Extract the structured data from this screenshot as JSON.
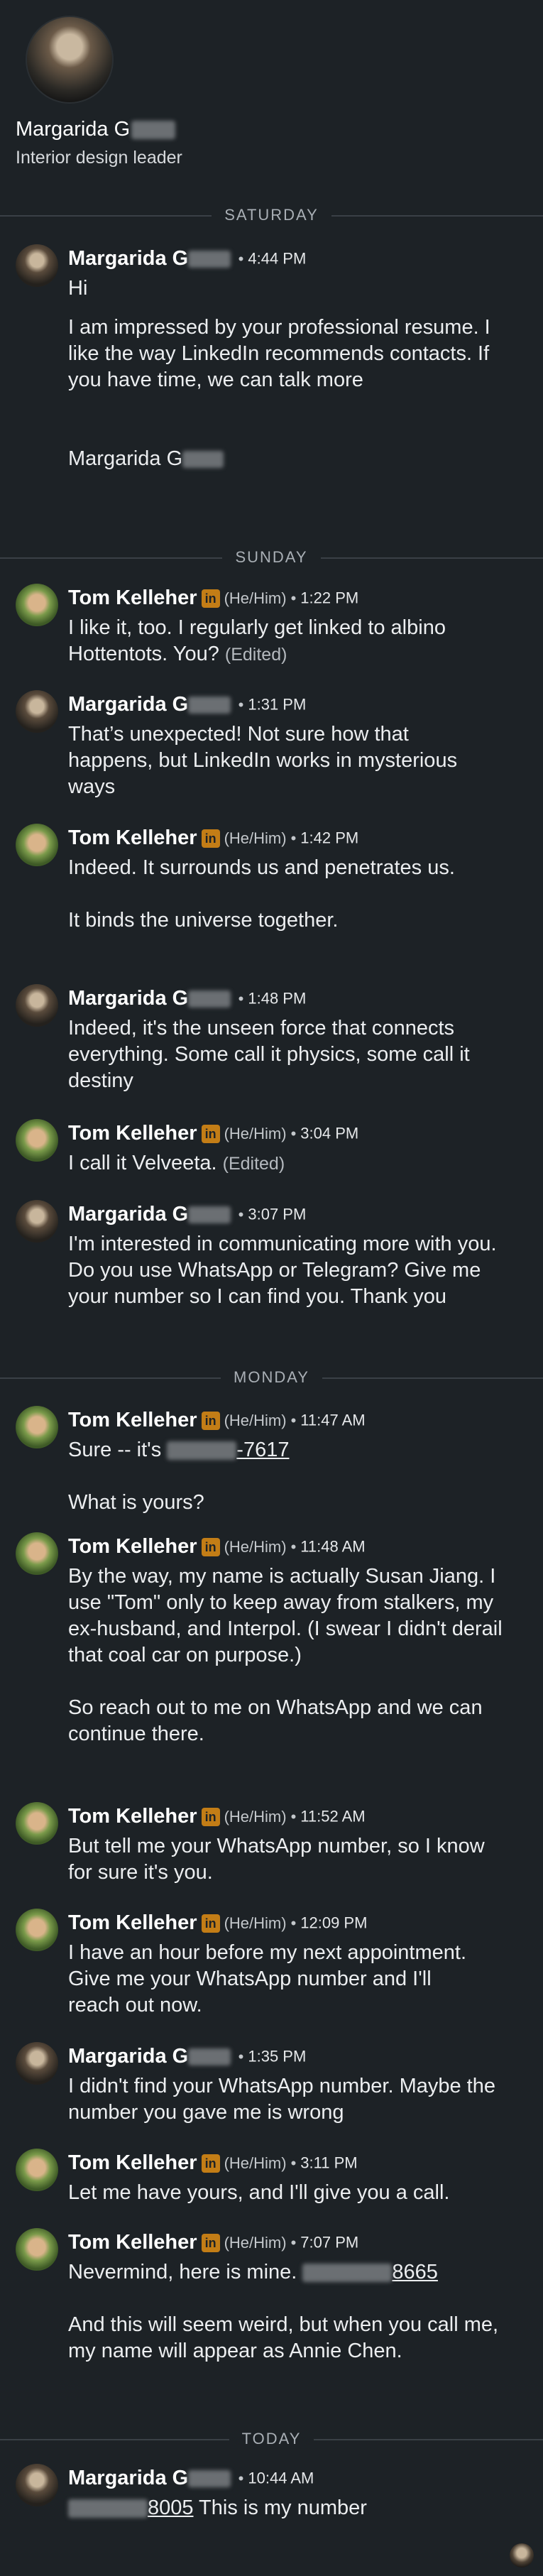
{
  "profile": {
    "name": "Margarida G",
    "headline": "Interior design leader"
  },
  "days": {
    "saturday": "SATURDAY",
    "sunday": "SUNDAY",
    "monday": "MONDAY",
    "today": "TODAY"
  },
  "messages": [
    {
      "author": "Margarida G",
      "time": "4:44 PM",
      "lines": [
        "Hi",
        "I am impressed by your professional resume. I like the way LinkedIn recommends contacts. If you have time, we can talk more",
        "Margarida G"
      ]
    },
    {
      "author": "Tom Kelleher",
      "badge": "in",
      "pronouns": "(He/Him)",
      "time": "1:22 PM",
      "lines": [
        "I like it, too.  I regularly get linked to albino Hottentots.  You?"
      ],
      "edited": "(Edited)"
    },
    {
      "author": "Margarida G",
      "time": "1:31 PM",
      "lines": [
        "That’s unexpected! Not sure how that happens, but LinkedIn works in mysterious ways"
      ]
    },
    {
      "author": "Tom Kelleher",
      "badge": "in",
      "pronouns": "(He/Him)",
      "time": "1:42 PM",
      "lines": [
        "Indeed.  It surrounds us and penetrates us.",
        "It binds the universe together."
      ]
    },
    {
      "author": "Margarida G",
      "time": "1:48 PM",
      "lines": [
        "Indeed, it's the unseen force that connects everything. Some call it physics, some call it destiny"
      ]
    },
    {
      "author": "Tom Kelleher",
      "badge": "in",
      "pronouns": "(He/Him)",
      "time": "3:04 PM",
      "lines": [
        "I call it Velveeta."
      ],
      "edited": "(Edited)"
    },
    {
      "author": "Margarida G",
      "time": "3:07 PM",
      "lines": [
        "I'm interested in communicating more with you. Do you use WhatsApp or Telegram? Give me your number so I can find you. Thank you"
      ]
    },
    {
      "author": "Tom Kelleher",
      "badge": "in",
      "pronouns": "(He/Him)",
      "time": "11:47 AM",
      "prefix": "Sure -- it's",
      "phone": "-7617",
      "lines": [
        "What is yours?"
      ]
    },
    {
      "author": "Tom Kelleher",
      "badge": "in",
      "pronouns": "(He/Him)",
      "time": "11:48 AM",
      "lines": [
        "By the way, my name is actually Susan Jiang.  I use \"Tom\" only to keep away from stalkers, my ex-husband, and Interpol. (I swear I didn't derail that coal car on purpose.)",
        "So reach out to me on WhatsApp and we can continue there."
      ]
    },
    {
      "author": "Tom Kelleher",
      "badge": "in",
      "pronouns": "(He/Him)",
      "time": "11:52 AM",
      "lines": [
        "But tell me your WhatsApp number, so I know for sure it's you."
      ]
    },
    {
      "author": "Tom Kelleher",
      "badge": "in",
      "pronouns": "(He/Him)",
      "time": "12:09 PM",
      "lines": [
        "I have an hour before my next appointment.  Give me your WhatsApp number and I'll reach out now."
      ]
    },
    {
      "author": "Margarida G",
      "time": "1:35 PM",
      "lines": [
        "I didn't find your WhatsApp number. Maybe the number you gave me is wrong"
      ]
    },
    {
      "author": "Tom Kelleher",
      "badge": "in",
      "pronouns": "(He/Him)",
      "time": "3:11 PM",
      "lines": [
        "Let me have yours, and I'll give you a call."
      ]
    },
    {
      "author": "Tom Kelleher",
      "badge": "in",
      "pronouns": "(He/Him)",
      "time": "7:07 PM",
      "prefix": "Nevermind, here is mine.",
      "phone": "8665",
      "lines": [
        "And this will seem weird, but when you call me, my name will appear as Annie Chen."
      ]
    },
    {
      "author": "Margarida G",
      "time": "10:44 AM",
      "phone": "8005",
      "suffix": " This is my number"
    }
  ],
  "colors": {
    "background": "#1d2226",
    "linkedin_badge": "#c37d16",
    "divider": "#3a4046"
  }
}
